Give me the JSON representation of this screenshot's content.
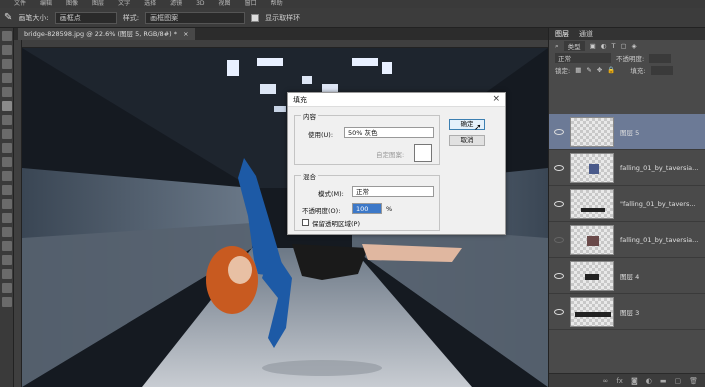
{
  "menu": [
    "文件",
    "编辑",
    "图像",
    "图层",
    "文字",
    "选择",
    "滤镜",
    "3D",
    "视图",
    "窗口",
    "帮助"
  ],
  "options": {
    "brush_size_label": "画笔大小:",
    "brush_size_value": "画框点",
    "style_label": "样式:",
    "style_value": "画框图案",
    "show_sample_label": "显示取样环"
  },
  "document": {
    "tab_title": "bridge-828598.jpg @ 22.6% (图层 5, RGB/8#) *",
    "tab_close": "×"
  },
  "layers_panel": {
    "tab_layers": "图层",
    "tab_channels": "通道",
    "kind_label": "类型",
    "blend_mode": "正常",
    "opacity_label": "不透明度:",
    "lock_label": "锁定:",
    "fill_label": "填充:",
    "layers": [
      {
        "name": "图层 5",
        "selected": true,
        "visible": true
      },
      {
        "name": "falling_01_by_taversia...",
        "selected": false,
        "visible": true
      },
      {
        "name": "\"falling_01_by_tavers...",
        "selected": false,
        "visible": true
      },
      {
        "name": "falling_01_by_taversia...",
        "selected": false,
        "visible": false
      },
      {
        "name": "图层 4",
        "selected": false,
        "visible": true
      },
      {
        "name": "图层 3",
        "selected": false,
        "visible": true
      }
    ],
    "bottom_icons": [
      "link-icon",
      "fx-icon",
      "mask-icon",
      "adjustment-icon",
      "folder-icon",
      "new-layer-icon",
      "trash-icon"
    ]
  },
  "fill_dialog": {
    "title": "填充",
    "close": "×",
    "content_group": "内容",
    "use_label": "使用(U):",
    "use_value": "50% 灰色",
    "custom_pattern_label": "自定图案:",
    "blend_group": "混合",
    "mode_label": "模式(M):",
    "mode_value": "正常",
    "opacity_label": "不透明度(O):",
    "opacity_value": "100",
    "opacity_unit": "%",
    "preserve_label": "保留透明区域(P)",
    "ok": "确定",
    "cancel": "取消"
  },
  "colors": {
    "panel_bg": "#4a4a4a",
    "selected_layer": "#6c7a96",
    "dialog_bg": "#f0f0f0",
    "ok_border": "#3c7fb1"
  }
}
